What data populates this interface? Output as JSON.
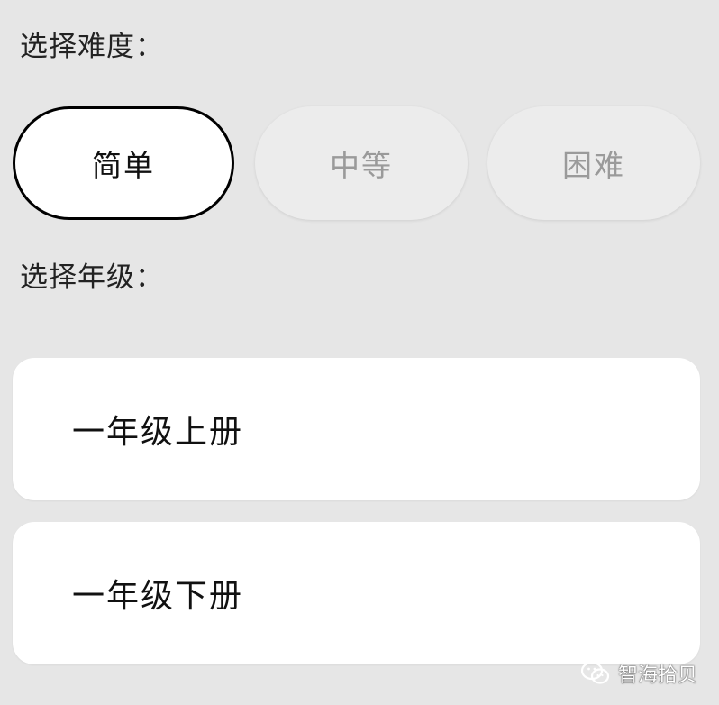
{
  "difficulty": {
    "label": "选择难度：",
    "options": [
      {
        "label": "简单",
        "selected": true
      },
      {
        "label": "中等",
        "selected": false
      },
      {
        "label": "困难",
        "selected": false
      }
    ]
  },
  "grade": {
    "label": "选择年级：",
    "options": [
      {
        "label": "一年级上册"
      },
      {
        "label": "一年级下册"
      }
    ]
  },
  "watermark": {
    "text": "智海拾贝",
    "icon": "wechat-icon"
  },
  "colors": {
    "background": "#e6e6e6",
    "selected_border": "#000000",
    "unselected_text": "#9a9a9a",
    "card_background": "#ffffff"
  }
}
